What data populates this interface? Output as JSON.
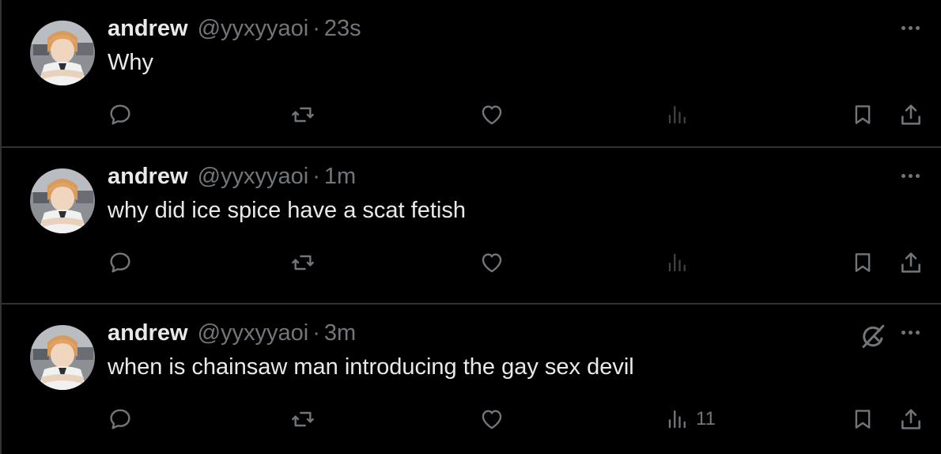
{
  "tweets": [
    {
      "name": "andrew",
      "handle": "@yyxyyaoi",
      "separator": "·",
      "time": "23s",
      "text": "Why",
      "views": ""
    },
    {
      "name": "andrew",
      "handle": "@yyxyyaoi",
      "separator": "·",
      "time": "1m",
      "text": "why did ice spice have a scat fetish",
      "views": ""
    },
    {
      "name": "andrew",
      "handle": "@yyxyyaoi",
      "separator": "·",
      "time": "3m",
      "text": "when is chainsaw man introducing the gay sex devil",
      "views": "11"
    }
  ],
  "icons": {
    "reply": "reply-icon",
    "retweet": "retweet-icon",
    "like": "heart-icon",
    "views": "analytics-icon",
    "bookmark": "bookmark-icon",
    "share": "share-icon",
    "more": "more-icon",
    "grok": "grok-icon"
  },
  "colors": {
    "background": "#000000",
    "text": "#e7e9ea",
    "muted": "#71767b",
    "divider": "#2f3336",
    "analytics_dim": "#3e4144"
  }
}
